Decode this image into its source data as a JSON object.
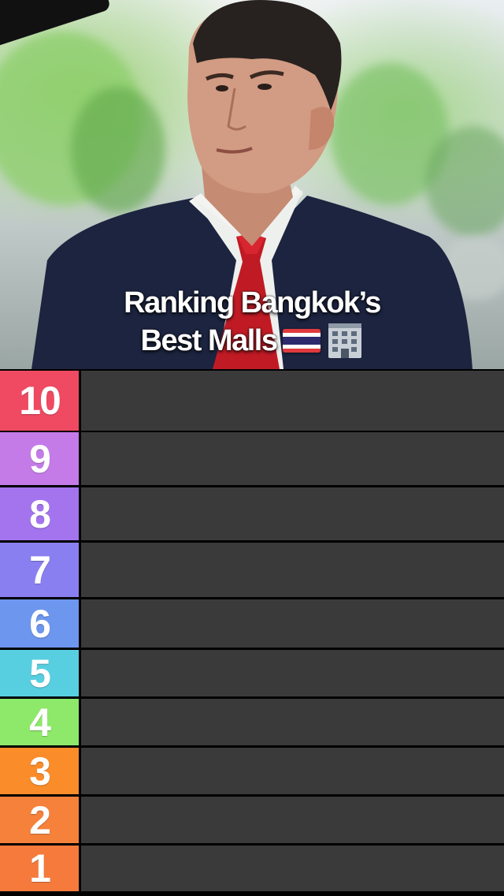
{
  "title": {
    "line1": "Ranking Bangkok’s",
    "line2": "Best Malls",
    "emoji_flag": "thailand-flag-icon",
    "emoji_building": "office-building-icon"
  },
  "tiers": [
    {
      "label": "10",
      "color": "#ef4a62"
    },
    {
      "label": "9",
      "color": "#c47be8"
    },
    {
      "label": "8",
      "color": "#a374ee"
    },
    {
      "label": "7",
      "color": "#8a7ff0"
    },
    {
      "label": "6",
      "color": "#6d96ee"
    },
    {
      "label": "5",
      "color": "#58cfe0"
    },
    {
      "label": "4",
      "color": "#8ee86a"
    },
    {
      "label": "3",
      "color": "#fa8c2a"
    },
    {
      "label": "2",
      "color": "#f6813a"
    },
    {
      "label": "1",
      "color": "#f57a3c"
    }
  ]
}
